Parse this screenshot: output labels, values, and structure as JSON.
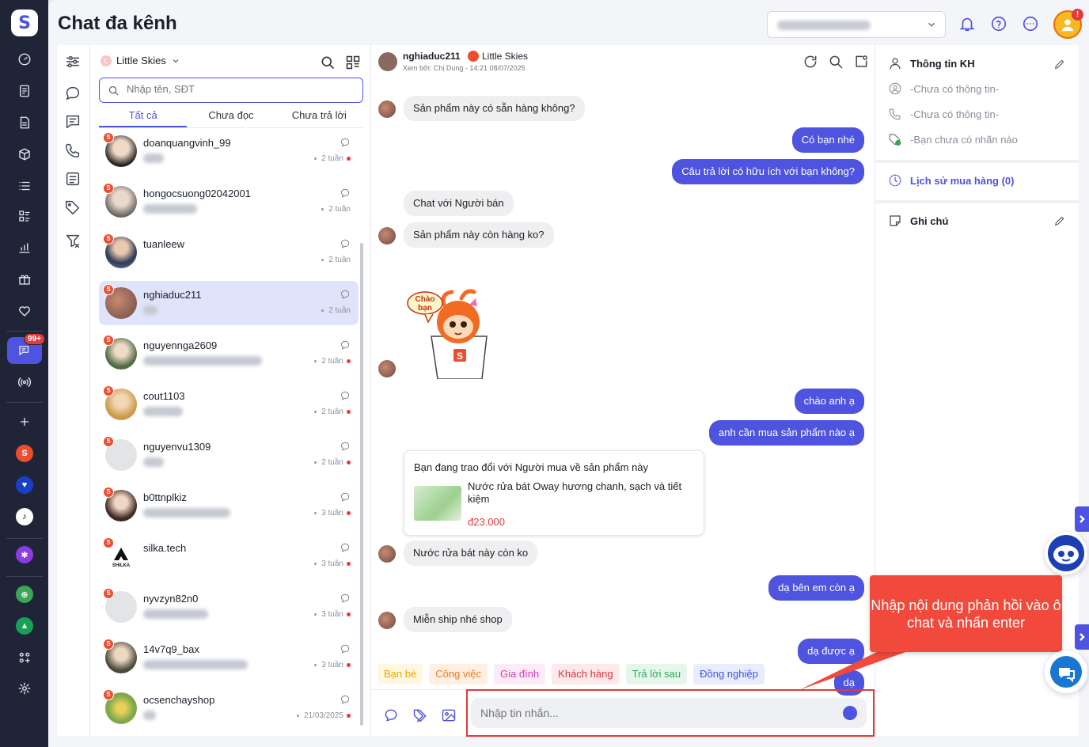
{
  "app": {
    "title": "Chat đa kênh",
    "accent": "#4e53e0",
    "notification_badge": "!"
  },
  "rail": {
    "items": [
      {
        "name": "dashboard-icon"
      },
      {
        "name": "orders-icon"
      },
      {
        "name": "documents-icon"
      },
      {
        "name": "products-icon"
      },
      {
        "name": "list-icon"
      },
      {
        "name": "tasks-icon"
      },
      {
        "name": "reports-icon"
      },
      {
        "name": "gift-icon"
      },
      {
        "name": "heart-icon"
      },
      {
        "name": "chat-icon",
        "badge": "99+"
      },
      {
        "name": "broadcast-icon"
      }
    ]
  },
  "header": {
    "shop_selector_value": "",
    "icons": [
      "bell-icon",
      "help-icon",
      "more-icon"
    ]
  },
  "list": {
    "shop_name": "Little Skies",
    "search_placeholder": "Nhập tên, SĐT",
    "tabs": [
      "Tất cả",
      "Chưa đọc",
      "Chưa trả lời"
    ],
    "conversations": [
      {
        "name": "doanquangvinh_99",
        "time": "2 tuần",
        "unread": true,
        "active": false
      },
      {
        "name": "hongocsuong02042001",
        "time": "2 tuần",
        "unread": false,
        "active": false
      },
      {
        "name": "tuanleew",
        "time": "2 tuần",
        "unread": false,
        "active": false
      },
      {
        "name": "nghiaduc211",
        "time": "2 tuần",
        "unread": false,
        "active": true
      },
      {
        "name": "nguyennga2609",
        "time": "2 tuần",
        "unread": true,
        "active": false
      },
      {
        "name": "cout1103",
        "time": "2 tuần",
        "unread": true,
        "active": false
      },
      {
        "name": "nguyenvu1309",
        "time": "2 tuần",
        "unread": true,
        "active": false
      },
      {
        "name": "b0ttnplkiz",
        "time": "3 tuần",
        "unread": true,
        "active": false
      },
      {
        "name": "silka.tech",
        "time": "3 tuần",
        "unread": true,
        "active": false
      },
      {
        "name": "nyvzyn82n0",
        "time": "3 tuần",
        "unread": true,
        "active": false
      },
      {
        "name": "14v7q9_bax",
        "time": "3 tuần",
        "unread": true,
        "active": false
      },
      {
        "name": "ocsenchayshop",
        "time": "21/03/2025",
        "unread": true,
        "active": false
      }
    ]
  },
  "chat": {
    "customer": "nghiaduc211",
    "shop": "Little Skies",
    "seen_by": "Xem bởi: Chị Dung - 14:21 08/07/2025",
    "messages": [
      {
        "dir": "in",
        "text": "Sản phẩm này có sẵn hàng không?"
      },
      {
        "dir": "out",
        "text": "Có bạn nhé"
      },
      {
        "dir": "out",
        "text": "Câu trả lời có hữu ích với bạn không?"
      },
      {
        "dir": "in",
        "text": "Chat với Người bán"
      },
      {
        "dir": "in",
        "text": "Sản phẩm này còn hàng ko?"
      },
      {
        "dir": "out",
        "text": "chào anh ạ"
      },
      {
        "dir": "out",
        "text": "anh cần mua sản phẩm nào ạ"
      },
      {
        "dir": "in",
        "text": "Nước rửa bát này còn ko"
      },
      {
        "dir": "out",
        "text": "dạ bên em còn ạ"
      },
      {
        "dir": "in",
        "text": "Miễn ship nhé shop"
      },
      {
        "dir": "out",
        "text": "dạ được ạ"
      },
      {
        "dir": "out",
        "text": "dạ"
      }
    ],
    "sticker_text": "Chào bạn",
    "product_card": {
      "title": "Bạn đang trao đổi với Người mua về sản phẩm này",
      "product_name": "Nước rửa bát Oway hương chanh, sạch và tiết kiệm",
      "price": "đ23.000"
    },
    "labels": [
      {
        "text": "Bạn bè",
        "color": "#e6a800",
        "bg": "#fff7e0"
      },
      {
        "text": "Công việc",
        "color": "#f07a1c",
        "bg": "#fff0e3"
      },
      {
        "text": "Gia đình",
        "color": "#d63fb5",
        "bg": "#fdebf8"
      },
      {
        "text": "Khách hàng",
        "color": "#d9363e",
        "bg": "#fde9ea"
      },
      {
        "text": "Trả lời sau",
        "color": "#2fa85a",
        "bg": "#e6f6ec"
      },
      {
        "text": "Đồng nghiệp",
        "color": "#3d57e0",
        "bg": "#e8ecfd"
      }
    ],
    "input_placeholder": "Nhập tin nhắn..."
  },
  "info": {
    "title": "Thông tin KH",
    "name_value": "-Chưa có thông tin-",
    "phone_value": "-Chưa có thông tin-",
    "tag_value": "-Bạn chưa có nhãn nào",
    "purchase_history": "Lịch sử mua hàng (0)",
    "notes_title": "Ghi chú"
  },
  "callout": {
    "text": "Nhập nội dung phản hồi vào ô chat và nhấn enter"
  }
}
